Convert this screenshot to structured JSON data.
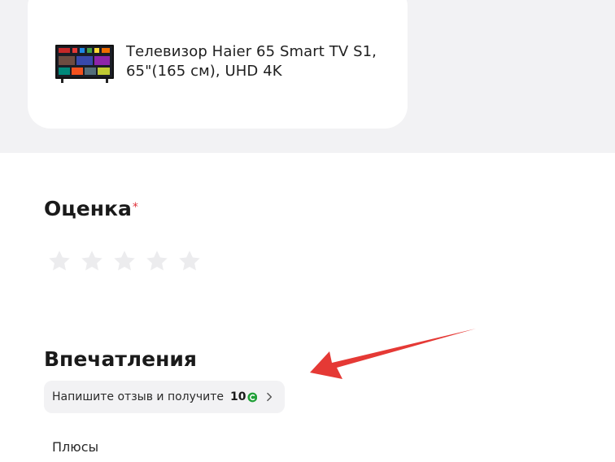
{
  "product": {
    "title": "Телевизор Haier 65 Smart TV S1, 65\"(165 см), UHD 4K",
    "thumbnail_icon": "tv-thumbnail"
  },
  "rating": {
    "heading": "Оценка",
    "required_mark": "*",
    "stars_total": 5,
    "stars_selected": 0
  },
  "impressions": {
    "heading": "Впечатления",
    "bonus_text": "Напишите отзыв и получите",
    "bonus_amount": "10",
    "bonus_icon": "bonus-coin-icon",
    "chevron_icon": "chevron-right-icon"
  },
  "form": {
    "pros_label": "Плюсы"
  },
  "colors": {
    "background_band": "#f2f2f4",
    "required_red": "#e0323a",
    "bonus_green": "#21a038",
    "star_empty": "#ececee",
    "annotation_arrow": "#e53935"
  }
}
